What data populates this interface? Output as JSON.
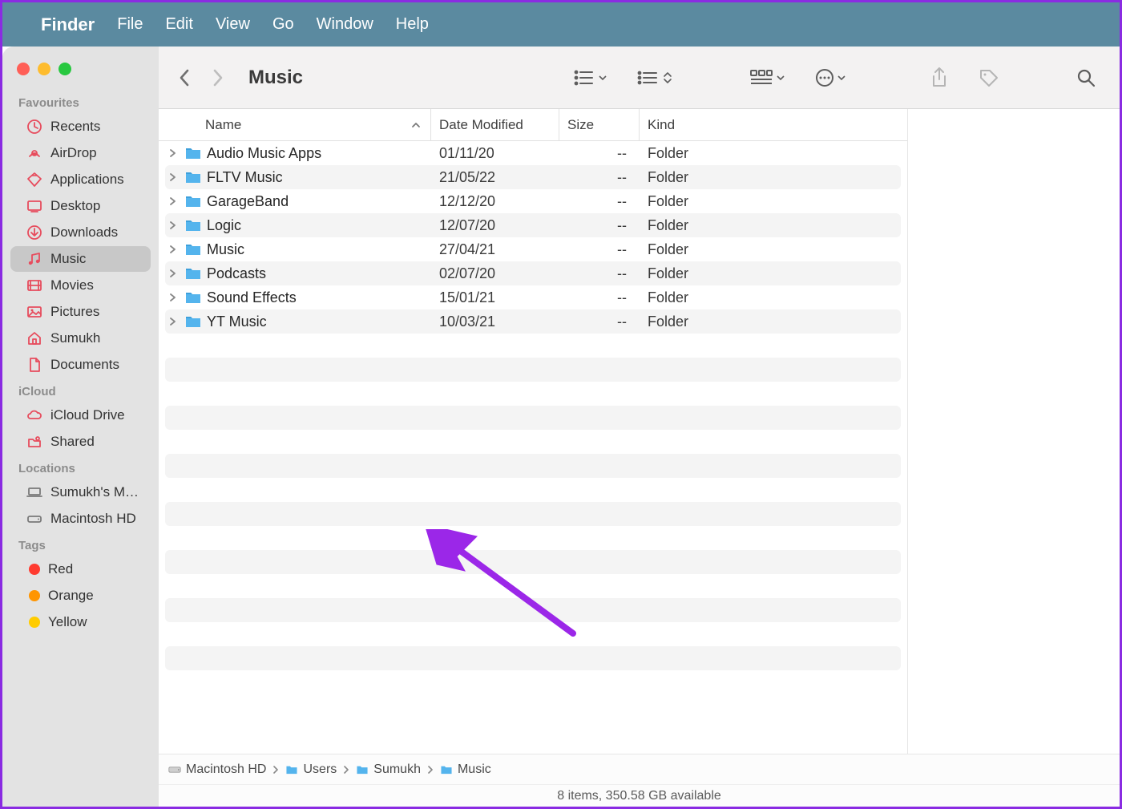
{
  "menubar": {
    "app": "Finder",
    "items": [
      "File",
      "Edit",
      "View",
      "Go",
      "Window",
      "Help"
    ]
  },
  "window": {
    "title": "Music"
  },
  "sidebar": {
    "sections": [
      {
        "header": "Favourites",
        "items": [
          {
            "icon": "recents",
            "label": "Recents"
          },
          {
            "icon": "airdrop",
            "label": "AirDrop"
          },
          {
            "icon": "apps",
            "label": "Applications"
          },
          {
            "icon": "desktop",
            "label": "Desktop"
          },
          {
            "icon": "downloads",
            "label": "Downloads"
          },
          {
            "icon": "music",
            "label": "Music",
            "selected": true
          },
          {
            "icon": "movies",
            "label": "Movies"
          },
          {
            "icon": "pictures",
            "label": "Pictures"
          },
          {
            "icon": "home",
            "label": "Sumukh"
          },
          {
            "icon": "documents",
            "label": "Documents"
          }
        ]
      },
      {
        "header": "iCloud",
        "items": [
          {
            "icon": "icloud",
            "label": "iCloud Drive"
          },
          {
            "icon": "shared",
            "label": "Shared"
          }
        ]
      },
      {
        "header": "Locations",
        "items": [
          {
            "icon": "laptop",
            "label": "Sumukh's M…",
            "gray": true
          },
          {
            "icon": "hd",
            "label": "Macintosh HD",
            "gray": true
          }
        ]
      },
      {
        "header": "Tags",
        "items": [
          {
            "icon": "tagdot",
            "color": "#ff3b30",
            "label": "Red"
          },
          {
            "icon": "tagdot",
            "color": "#ff9500",
            "label": "Orange"
          },
          {
            "icon": "tagdot",
            "color": "#ffcc00",
            "label": "Yellow"
          }
        ]
      }
    ]
  },
  "columns": {
    "name": "Name",
    "date": "Date Modified",
    "size": "Size",
    "kind": "Kind"
  },
  "files": [
    {
      "name": "Audio Music Apps",
      "date": "01/11/20",
      "size": "--",
      "kind": "Folder"
    },
    {
      "name": "FLTV Music",
      "date": "21/05/22",
      "size": "--",
      "kind": "Folder"
    },
    {
      "name": "GarageBand",
      "date": "12/12/20",
      "size": "--",
      "kind": "Folder"
    },
    {
      "name": "Logic",
      "date": "12/07/20",
      "size": "--",
      "kind": "Folder"
    },
    {
      "name": "Music",
      "date": "27/04/21",
      "size": "--",
      "kind": "Folder"
    },
    {
      "name": "Podcasts",
      "date": "02/07/20",
      "size": "--",
      "kind": "Folder"
    },
    {
      "name": "Sound Effects",
      "date": "15/01/21",
      "size": "--",
      "kind": "Folder"
    },
    {
      "name": "YT Music",
      "date": "10/03/21",
      "size": "--",
      "kind": "Folder"
    }
  ],
  "pathbar": [
    {
      "icon": "hd",
      "label": "Macintosh HD"
    },
    {
      "icon": "folder",
      "label": "Users"
    },
    {
      "icon": "folder",
      "label": "Sumukh"
    },
    {
      "icon": "folder",
      "label": "Music"
    }
  ],
  "status": "8 items, 350.58 GB available"
}
